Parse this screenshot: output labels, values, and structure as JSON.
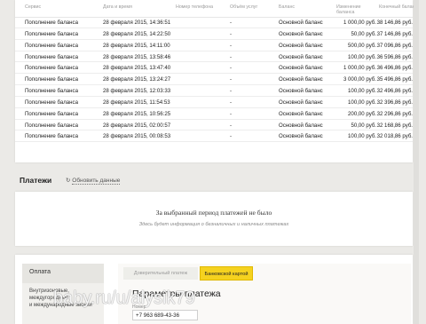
{
  "transactions": {
    "headers": {
      "service": "Сервис",
      "date": "Дата и время",
      "phone": "Номер телефона",
      "volume": "Объём услуг",
      "balance": "Баланс",
      "change": "Изменение баланса",
      "final": "Конечный баланс"
    },
    "rows": [
      {
        "service": "Пополнение баланса",
        "date": "28 февраля 2015, 14:36:51",
        "phone": "",
        "volume": "-",
        "balance": "Основной баланс",
        "change": "1 000,00 руб.",
        "final": "38 146,86 руб."
      },
      {
        "service": "Пополнение баланса",
        "date": "28 февраля 2015, 14:22:50",
        "phone": "",
        "volume": "-",
        "balance": "Основной баланс",
        "change": "50,00 руб.",
        "final": "37 146,86 руб."
      },
      {
        "service": "Пополнение баланса",
        "date": "28 февраля 2015, 14:11:00",
        "phone": "",
        "volume": "-",
        "balance": "Основной баланс",
        "change": "500,00 руб.",
        "final": "37 096,86 руб."
      },
      {
        "service": "Пополнение баланса",
        "date": "28 февраля 2015, 13:58:46",
        "phone": "",
        "volume": "-",
        "balance": "Основной баланс",
        "change": "100,00 руб.",
        "final": "36 596,86 руб."
      },
      {
        "service": "Пополнение баланса",
        "date": "28 февраля 2015, 13:47:40",
        "phone": "",
        "volume": "-",
        "balance": "Основной баланс",
        "change": "1 000,00 руб.",
        "final": "36 496,86 руб."
      },
      {
        "service": "Пополнение баланса",
        "date": "28 февраля 2015, 13:24:27",
        "phone": "",
        "volume": "-",
        "balance": "Основной баланс",
        "change": "3 000,00 руб.",
        "final": "35 496,86 руб."
      },
      {
        "service": "Пополнение баланса",
        "date": "28 февраля 2015, 12:03:33",
        "phone": "",
        "volume": "-",
        "balance": "Основной баланс",
        "change": "100,00 руб.",
        "final": "32 496,86 руб."
      },
      {
        "service": "Пополнение баланса",
        "date": "28 февраля 2015, 11:54:53",
        "phone": "",
        "volume": "-",
        "balance": "Основной баланс",
        "change": "100,00 руб.",
        "final": "32 396,86 руб."
      },
      {
        "service": "Пополнение баланса",
        "date": "28 февраля 2015, 10:56:25",
        "phone": "",
        "volume": "-",
        "balance": "Основной баланс",
        "change": "200,00 руб.",
        "final": "32 296,86 руб."
      },
      {
        "service": "Пополнение баланса",
        "date": "28 февраля 2015, 02:00:57",
        "phone": "",
        "volume": "-",
        "balance": "Основной баланс",
        "change": "50,00 руб.",
        "final": "32 168,86 руб."
      },
      {
        "service": "Пополнение баланса",
        "date": "28 февраля 2015, 00:08:53",
        "phone": "",
        "volume": "-",
        "balance": "Основной баланс",
        "change": "100,00 руб.",
        "final": "32 018,86 руб."
      }
    ]
  },
  "payments": {
    "title": "Платежи",
    "refresh_icon": "↻",
    "refresh_label": "Обновить данные",
    "empty_title": "За выбранный период платежей не было",
    "empty_subtitle": "Здесь будет информация о безналичных и наличных платежах"
  },
  "payment_form": {
    "side_menu": {
      "item1": "Оплата",
      "item2_line1": "Внутризоновые, междугородные",
      "item2_line2": "и международные звонки"
    },
    "tabs": {
      "tab1": "Доверительный платеж",
      "tab2": "Банковской картой"
    },
    "title": "Параметры платежа",
    "phone_label": "Номер",
    "phone_value": "+7 963 689-43-36"
  },
  "watermark": "baby.ru/u/alysik79",
  "colors": {
    "page_bg": "#ebeae7",
    "accent_yellow": "#f5d21f"
  }
}
